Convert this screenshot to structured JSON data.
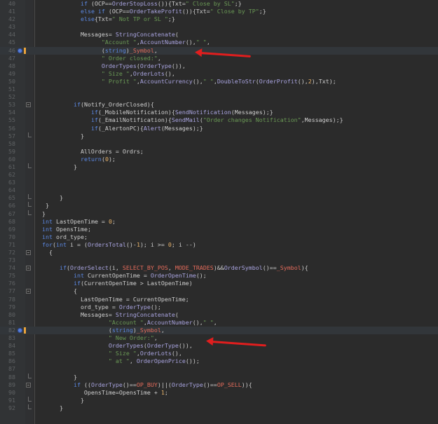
{
  "code_lines": [
    {
      "n": "40",
      "tokens": [
        {
          "t": "            ",
          "c": "id"
        },
        {
          "t": "if",
          "c": "kw"
        },
        {
          "t": " (OCP==",
          "c": "id"
        },
        {
          "t": "OrderStopLoss",
          "c": "fn"
        },
        {
          "t": "()){Txt=",
          "c": "id"
        },
        {
          "t": "\" Close by SL\"",
          "c": "str"
        },
        {
          "t": ";}",
          "c": "id"
        }
      ]
    },
    {
      "n": "41",
      "tokens": [
        {
          "t": "            ",
          "c": "id"
        },
        {
          "t": "else if",
          "c": "kw"
        },
        {
          "t": " (OCP==",
          "c": "id"
        },
        {
          "t": "OrderTakeProfit",
          "c": "fn"
        },
        {
          "t": "()){Txt=",
          "c": "id"
        },
        {
          "t": "\" Close by TP\"",
          "c": "str"
        },
        {
          "t": ";}",
          "c": "id"
        }
      ]
    },
    {
      "n": "42",
      "tokens": [
        {
          "t": "            ",
          "c": "id"
        },
        {
          "t": "else",
          "c": "kw"
        },
        {
          "t": "{Txt=",
          "c": "id"
        },
        {
          "t": "\" Not TP or SL \"",
          "c": "str"
        },
        {
          "t": ";}",
          "c": "id"
        }
      ]
    },
    {
      "n": "43",
      "tokens": []
    },
    {
      "n": "44",
      "tokens": [
        {
          "t": "            Messages= ",
          "c": "id"
        },
        {
          "t": "StringConcatenate",
          "c": "fn"
        },
        {
          "t": "(",
          "c": "id"
        }
      ]
    },
    {
      "n": "45",
      "tokens": [
        {
          "t": "                  ",
          "c": "id"
        },
        {
          "t": "\"Account \"",
          "c": "str"
        },
        {
          "t": ",",
          "c": "id"
        },
        {
          "t": "AccountNumber",
          "c": "fn"
        },
        {
          "t": "(),",
          "c": "id"
        },
        {
          "t": "\" \"",
          "c": "str"
        },
        {
          "t": ",",
          "c": "id"
        }
      ]
    },
    {
      "n": "46",
      "mark": true,
      "tokens": [
        {
          "t": "                  (",
          "c": "id"
        },
        {
          "t": "string",
          "c": "kw"
        },
        {
          "t": ")",
          "c": "id"
        },
        {
          "t": "_Symbol",
          "c": "const"
        },
        {
          "t": ",",
          "c": "id"
        }
      ]
    },
    {
      "n": "47",
      "tokens": [
        {
          "t": "                  ",
          "c": "id"
        },
        {
          "t": "\" Order closed:\"",
          "c": "str"
        },
        {
          "t": ",",
          "c": "id"
        }
      ]
    },
    {
      "n": "48",
      "tokens": [
        {
          "t": "                  ",
          "c": "id"
        },
        {
          "t": "OrderTypes",
          "c": "fn"
        },
        {
          "t": "(",
          "c": "id"
        },
        {
          "t": "OrderType",
          "c": "fn"
        },
        {
          "t": "()),",
          "c": "id"
        }
      ]
    },
    {
      "n": "49",
      "tokens": [
        {
          "t": "                  ",
          "c": "id"
        },
        {
          "t": "\" Size \"",
          "c": "str"
        },
        {
          "t": ",",
          "c": "id"
        },
        {
          "t": "OrderLots",
          "c": "fn"
        },
        {
          "t": "(),",
          "c": "id"
        }
      ]
    },
    {
      "n": "50",
      "tokens": [
        {
          "t": "                  ",
          "c": "id"
        },
        {
          "t": "\" Profit \"",
          "c": "str"
        },
        {
          "t": ",",
          "c": "id"
        },
        {
          "t": "AccountCurrency",
          "c": "fn"
        },
        {
          "t": "(),",
          "c": "id"
        },
        {
          "t": "\" \"",
          "c": "str"
        },
        {
          "t": ",",
          "c": "id"
        },
        {
          "t": "DoubleToStr",
          "c": "fn"
        },
        {
          "t": "(",
          "c": "id"
        },
        {
          "t": "OrderProfit",
          "c": "fn"
        },
        {
          "t": "(),",
          "c": "id"
        },
        {
          "t": "2",
          "c": "num"
        },
        {
          "t": "),Txt);",
          "c": "id"
        }
      ]
    },
    {
      "n": "51",
      "tokens": []
    },
    {
      "n": "52",
      "tokens": []
    },
    {
      "n": "53",
      "fold": "open",
      "tokens": [
        {
          "t": "          ",
          "c": "id"
        },
        {
          "t": "if",
          "c": "kw"
        },
        {
          "t": "(Notify_OrderClosed){",
          "c": "id"
        }
      ]
    },
    {
      "n": "54",
      "tokens": [
        {
          "t": "               ",
          "c": "id"
        },
        {
          "t": "if",
          "c": "kw"
        },
        {
          "t": "(_MobileNotification){",
          "c": "id"
        },
        {
          "t": "SendNotification",
          "c": "fn"
        },
        {
          "t": "(Messages);}",
          "c": "id"
        }
      ]
    },
    {
      "n": "55",
      "tokens": [
        {
          "t": "               ",
          "c": "id"
        },
        {
          "t": "if",
          "c": "kw"
        },
        {
          "t": "(_EmailNotification){",
          "c": "id"
        },
        {
          "t": "SendMail",
          "c": "fn"
        },
        {
          "t": "(",
          "c": "id"
        },
        {
          "t": "\"Order changes Notification\"",
          "c": "str"
        },
        {
          "t": ",Messages);}",
          "c": "id"
        }
      ]
    },
    {
      "n": "56",
      "tokens": [
        {
          "t": "               ",
          "c": "id"
        },
        {
          "t": "if",
          "c": "kw"
        },
        {
          "t": "(_AlertonPC){",
          "c": "id"
        },
        {
          "t": "Alert",
          "c": "fn"
        },
        {
          "t": "(Messages);}",
          "c": "id"
        }
      ]
    },
    {
      "n": "57",
      "fold": "end",
      "tokens": [
        {
          "t": "            }",
          "c": "id"
        }
      ]
    },
    {
      "n": "58",
      "tokens": []
    },
    {
      "n": "59",
      "tokens": [
        {
          "t": "            AllOrders = Ordrs;",
          "c": "id"
        }
      ]
    },
    {
      "n": "60",
      "tokens": [
        {
          "t": "            ",
          "c": "id"
        },
        {
          "t": "return",
          "c": "kw"
        },
        {
          "t": "(",
          "c": "id"
        },
        {
          "t": "0",
          "c": "num"
        },
        {
          "t": ");",
          "c": "id"
        }
      ]
    },
    {
      "n": "61",
      "fold": "end",
      "tokens": [
        {
          "t": "          }",
          "c": "id"
        }
      ]
    },
    {
      "n": "62",
      "tokens": []
    },
    {
      "n": "63",
      "tokens": []
    },
    {
      "n": "64",
      "tokens": []
    },
    {
      "n": "65",
      "fold": "end",
      "tokens": [
        {
          "t": "      }",
          "c": "id"
        }
      ]
    },
    {
      "n": "66",
      "fold": "end",
      "tokens": [
        {
          "t": "  }",
          "c": "id"
        }
      ]
    },
    {
      "n": "67",
      "fold": "end",
      "tokens": [
        {
          "t": " }",
          "c": "id"
        }
      ]
    },
    {
      "n": "68",
      "tokens": [
        {
          "t": " ",
          "c": "id"
        },
        {
          "t": "int",
          "c": "kw"
        },
        {
          "t": " LastOpenTime = ",
          "c": "id"
        },
        {
          "t": "0",
          "c": "num"
        },
        {
          "t": ";",
          "c": "id"
        }
      ]
    },
    {
      "n": "69",
      "tokens": [
        {
          "t": " ",
          "c": "id"
        },
        {
          "t": "int",
          "c": "kw"
        },
        {
          "t": " OpensTime;",
          "c": "id"
        }
      ]
    },
    {
      "n": "70",
      "tokens": [
        {
          "t": " ",
          "c": "id"
        },
        {
          "t": "int",
          "c": "kw"
        },
        {
          "t": " ord_type;",
          "c": "id"
        }
      ]
    },
    {
      "n": "71",
      "tokens": [
        {
          "t": " ",
          "c": "id"
        },
        {
          "t": "for",
          "c": "kw"
        },
        {
          "t": "(",
          "c": "id"
        },
        {
          "t": "int",
          "c": "kw"
        },
        {
          "t": " i = (",
          "c": "id"
        },
        {
          "t": "OrdersTotal",
          "c": "fn"
        },
        {
          "t": "()-",
          "c": "id"
        },
        {
          "t": "1",
          "c": "num"
        },
        {
          "t": "); i >= ",
          "c": "id"
        },
        {
          "t": "0",
          "c": "num"
        },
        {
          "t": "; i --)",
          "c": "id"
        }
      ]
    },
    {
      "n": "72",
      "fold": "open",
      "tokens": [
        {
          "t": "   {",
          "c": "id"
        }
      ]
    },
    {
      "n": "73",
      "tokens": []
    },
    {
      "n": "74",
      "fold": "open",
      "tokens": [
        {
          "t": "      ",
          "c": "id"
        },
        {
          "t": "if",
          "c": "kw"
        },
        {
          "t": "(",
          "c": "id"
        },
        {
          "t": "OrderSelect",
          "c": "fn"
        },
        {
          "t": "(i, ",
          "c": "id"
        },
        {
          "t": "SELECT_BY_POS",
          "c": "const"
        },
        {
          "t": ", ",
          "c": "id"
        },
        {
          "t": "MODE_TRADES",
          "c": "const"
        },
        {
          "t": ")&&",
          "c": "id"
        },
        {
          "t": "OrderSymbol",
          "c": "fn"
        },
        {
          "t": "()==",
          "c": "id"
        },
        {
          "t": "_Symbol",
          "c": "const"
        },
        {
          "t": "){",
          "c": "id"
        }
      ]
    },
    {
      "n": "75",
      "tokens": [
        {
          "t": "          ",
          "c": "id"
        },
        {
          "t": "int",
          "c": "kw"
        },
        {
          "t": " CurrentOpenTime = ",
          "c": "id"
        },
        {
          "t": "OrderOpenTime",
          "c": "fn"
        },
        {
          "t": "();",
          "c": "id"
        }
      ]
    },
    {
      "n": "76",
      "tokens": [
        {
          "t": "          ",
          "c": "id"
        },
        {
          "t": "if",
          "c": "kw"
        },
        {
          "t": "(CurrentOpenTime > LastOpenTime)",
          "c": "id"
        }
      ]
    },
    {
      "n": "77",
      "fold": "open",
      "tokens": [
        {
          "t": "          {",
          "c": "id"
        }
      ]
    },
    {
      "n": "78",
      "tokens": [
        {
          "t": "            LastOpenTime = CurrentOpenTime;",
          "c": "id"
        }
      ]
    },
    {
      "n": "79",
      "tokens": [
        {
          "t": "            ord_type = ",
          "c": "id"
        },
        {
          "t": "OrderType",
          "c": "fn"
        },
        {
          "t": "();",
          "c": "id"
        }
      ]
    },
    {
      "n": "80",
      "tokens": [
        {
          "t": "            Messages= ",
          "c": "id"
        },
        {
          "t": "StringConcatenate",
          "c": "fn"
        },
        {
          "t": "(",
          "c": "id"
        }
      ]
    },
    {
      "n": "81",
      "tokens": [
        {
          "t": "                    ",
          "c": "id"
        },
        {
          "t": "\"Account \"",
          "c": "str"
        },
        {
          "t": ",",
          "c": "id"
        },
        {
          "t": "AccountNumber",
          "c": "fn"
        },
        {
          "t": "(),",
          "c": "id"
        },
        {
          "t": "\" \"",
          "c": "str"
        },
        {
          "t": ",",
          "c": "id"
        }
      ]
    },
    {
      "n": "82",
      "mark": true,
      "tokens": [
        {
          "t": "                    (",
          "c": "id"
        },
        {
          "t": "string",
          "c": "kw"
        },
        {
          "t": ")",
          "c": "id"
        },
        {
          "t": "_Symbol",
          "c": "const"
        },
        {
          "t": ",",
          "c": "id"
        }
      ]
    },
    {
      "n": "83",
      "tokens": [
        {
          "t": "                    ",
          "c": "id"
        },
        {
          "t": "\" New Order:\"",
          "c": "str"
        },
        {
          "t": ",",
          "c": "id"
        }
      ]
    },
    {
      "n": "84",
      "tokens": [
        {
          "t": "                    ",
          "c": "id"
        },
        {
          "t": "OrderTypes",
          "c": "fn"
        },
        {
          "t": "(",
          "c": "id"
        },
        {
          "t": "OrderType",
          "c": "fn"
        },
        {
          "t": "()),",
          "c": "id"
        }
      ]
    },
    {
      "n": "85",
      "tokens": [
        {
          "t": "                    ",
          "c": "id"
        },
        {
          "t": "\" Size \"",
          "c": "str"
        },
        {
          "t": ",",
          "c": "id"
        },
        {
          "t": "OrderLots",
          "c": "fn"
        },
        {
          "t": "(),",
          "c": "id"
        }
      ]
    },
    {
      "n": "86",
      "tokens": [
        {
          "t": "                    ",
          "c": "id"
        },
        {
          "t": "\" at \"",
          "c": "str"
        },
        {
          "t": ", ",
          "c": "id"
        },
        {
          "t": "OrderOpenPrice",
          "c": "fn"
        },
        {
          "t": "());",
          "c": "id"
        }
      ]
    },
    {
      "n": "87",
      "tokens": []
    },
    {
      "n": "88",
      "fold": "end",
      "tokens": [
        {
          "t": "          }",
          "c": "id"
        }
      ]
    },
    {
      "n": "89",
      "fold": "open",
      "tokens": [
        {
          "t": "          ",
          "c": "id"
        },
        {
          "t": "if",
          "c": "kw"
        },
        {
          "t": " ((",
          "c": "id"
        },
        {
          "t": "OrderType",
          "c": "fn"
        },
        {
          "t": "()==",
          "c": "id"
        },
        {
          "t": "OP_BUY",
          "c": "const"
        },
        {
          "t": ")||(",
          "c": "id"
        },
        {
          "t": "OrderType",
          "c": "fn"
        },
        {
          "t": "()==",
          "c": "id"
        },
        {
          "t": "OP_SELL",
          "c": "const"
        },
        {
          "t": ")){",
          "c": "id"
        }
      ]
    },
    {
      "n": "90",
      "tokens": [
        {
          "t": "             OpensTime=OpensTime + ",
          "c": "id"
        },
        {
          "t": "1",
          "c": "num"
        },
        {
          "t": ";",
          "c": "id"
        }
      ]
    },
    {
      "n": "91",
      "fold": "end",
      "tokens": [
        {
          "t": "            }",
          "c": "id"
        }
      ]
    },
    {
      "n": "92",
      "fold": "end",
      "tokens": [
        {
          "t": "      }",
          "c": "id"
        }
      ]
    }
  ]
}
